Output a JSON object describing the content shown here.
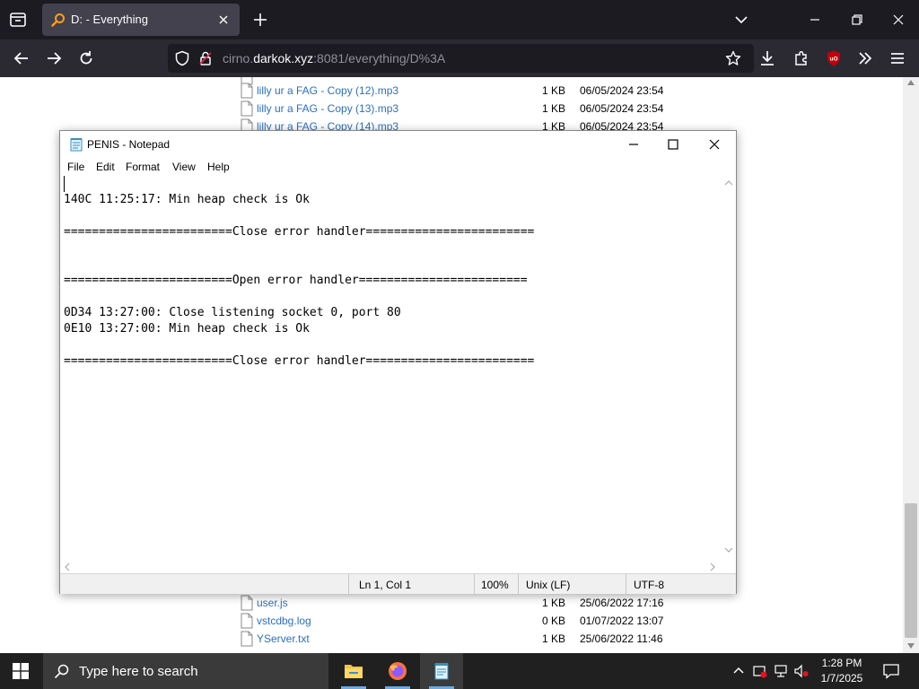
{
  "browser": {
    "tab": {
      "title": "D: - Everything"
    },
    "url": {
      "host_prefix": "cirno.",
      "host_domain": "darkok.xyz",
      "rest": ":8081/everything/D%3A"
    }
  },
  "listing": {
    "rows_top": [
      {
        "name": "lilly ur a FAG - Copy (12).mp3",
        "size": "1 KB",
        "date": "06/05/2024 23:54"
      },
      {
        "name": "lilly ur a FAG - Copy (13).mp3",
        "size": "1 KB",
        "date": "06/05/2024 23:54"
      },
      {
        "name": "lilly ur a FAG - Copy (14).mp3",
        "size": "1 KB",
        "date": "06/05/2024 23:54"
      }
    ],
    "rows_bottom": [
      {
        "name": "user.js",
        "size": "1 KB",
        "date": "25/06/2022 17:16"
      },
      {
        "name": "vstcdbg.log",
        "size": "0 KB",
        "date": "01/07/2022 13:07"
      },
      {
        "name": "YServer.txt",
        "size": "1 KB",
        "date": "25/06/2022 11:46"
      }
    ]
  },
  "notepad": {
    "title": "PENIS - Notepad",
    "menu": [
      "File",
      "Edit",
      "Format",
      "View",
      "Help"
    ],
    "content": "140C 11:25:17: Min heap check is Ok\n\n========================Close error handler========================\n\n\n========================Open error handler========================\n\n0D34 13:27:00: Close listening socket 0, port 80\n0E10 13:27:00: Min heap check is Ok\n\n========================Close error handler========================",
    "status": {
      "position": "Ln 1, Col 1",
      "zoom": "100%",
      "line_ending": "Unix (LF)",
      "encoding": "UTF-8"
    }
  },
  "taskbar": {
    "search_placeholder": "Type here to search",
    "time": "1:28 PM",
    "date": "1/7/2025"
  },
  "colors": {
    "browser_bg": "#1c1b22",
    "toolbar_bg": "#2b2a33",
    "link_blue": "#2a6fc4",
    "taskbar_bg": "#202020"
  }
}
